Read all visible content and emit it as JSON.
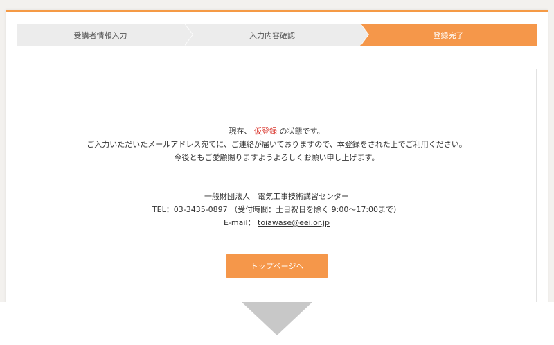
{
  "steps": {
    "step1": "受講者情報入力",
    "step2": "入力内容確認",
    "step3": "登録完了"
  },
  "message": {
    "line1_prefix": "現在、",
    "line1_highlight": "仮登録",
    "line1_suffix": "の状態です。",
    "line2": "ご入力いただいたメールアドレス宛てに、ご連絡が届いておりますので、本登録をされた上でご利用ください。",
    "line3": "今後ともご愛顧賜りますようよろしくお願い申し上げます。"
  },
  "contact": {
    "org": "一般財団法人　電気工事技術講習センター",
    "tel": "TEL：03-3435-0897 （受付時間：土日祝日を除く 9:00～17:00まで）",
    "email_label": "E-mail：",
    "email": "toiawase@eei.or.jp"
  },
  "button": {
    "top_page": "トップページへ"
  },
  "colors": {
    "accent": "#f5974a",
    "highlight": "#d9342b",
    "step_inactive": "#ececec"
  },
  "icons": {
    "next_arrow": "down-triangle-icon"
  }
}
